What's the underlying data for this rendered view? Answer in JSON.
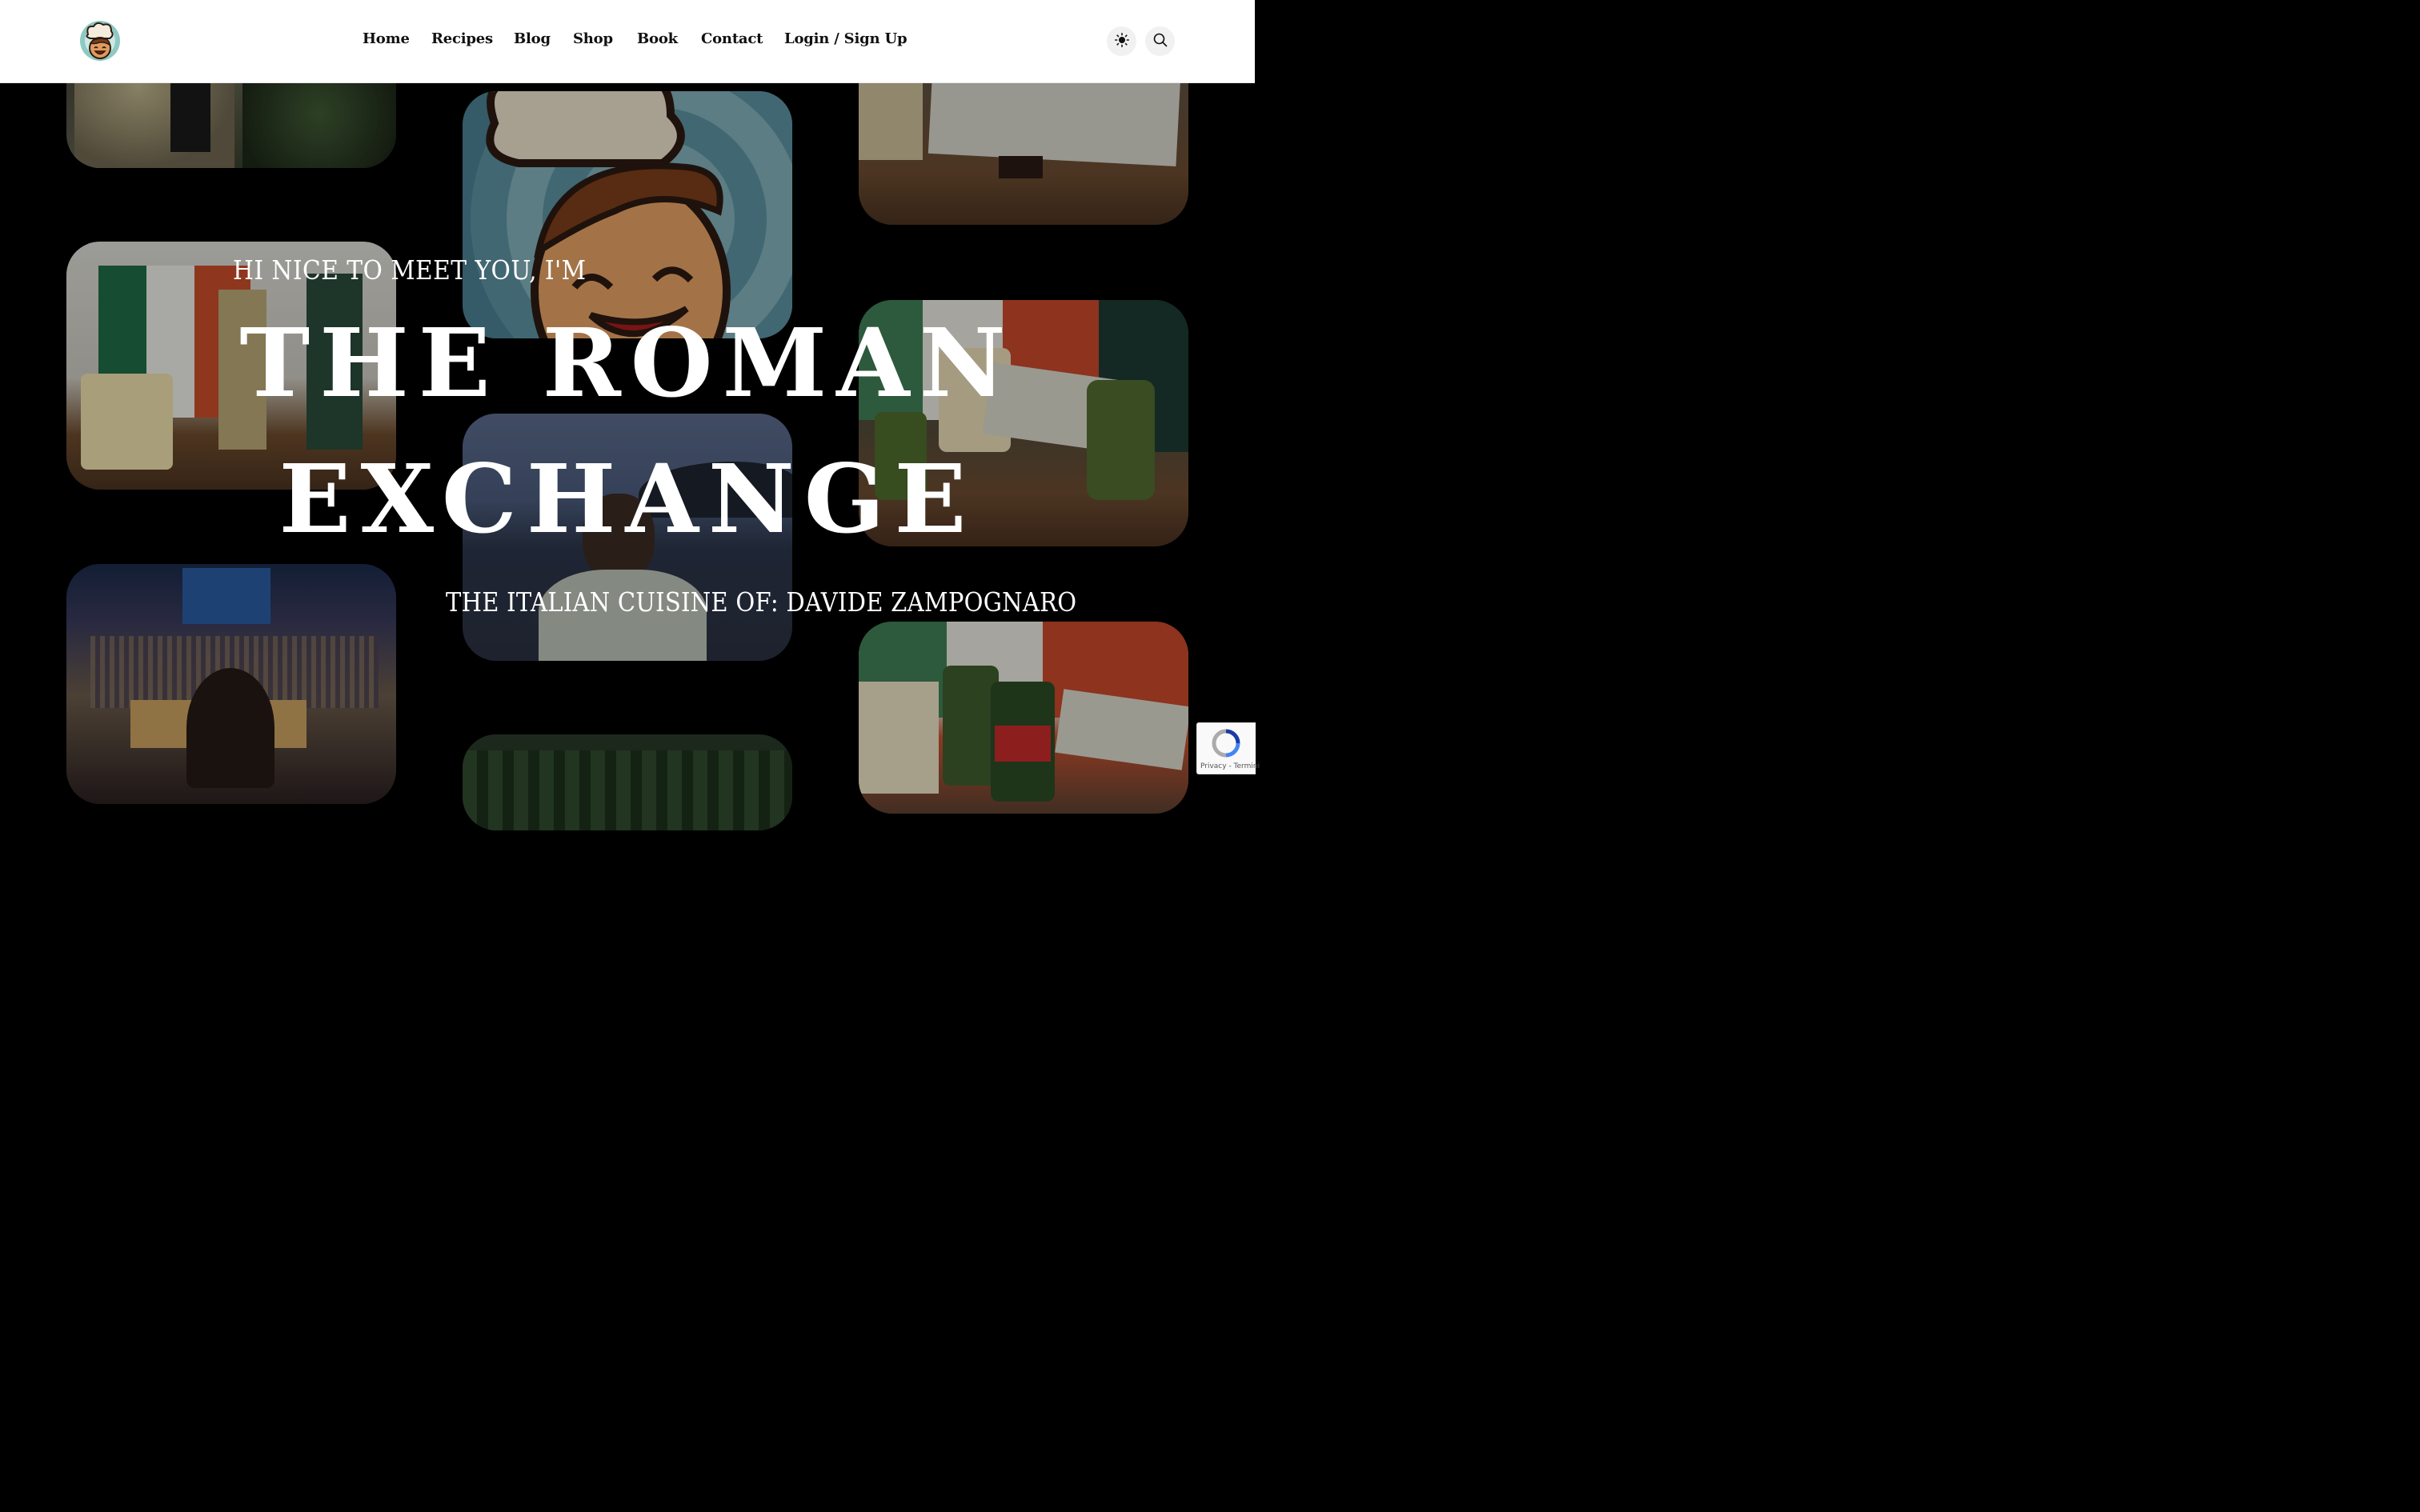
{
  "header": {
    "logo_icon": "chef-mascot-icon",
    "nav": [
      {
        "label": "Home"
      },
      {
        "label": "Recipes"
      },
      {
        "label": "Blog"
      },
      {
        "label": "Shop"
      },
      {
        "label": "Book"
      },
      {
        "label": "Contact"
      },
      {
        "label": "Login / Sign Up"
      }
    ],
    "theme_toggle_icon": "sun-icon",
    "search_icon": "search-icon"
  },
  "hero": {
    "intro": "HI NICE TO MEET YOU, I'M",
    "title_line1": "THE ROMAN",
    "title_line2": "EXCHANGE",
    "subtitle": "THE ITALIAN CUISINE OF: DAVIDE ZAMPOGNARO"
  },
  "recaptcha": {
    "links": "Privacy - Termini"
  },
  "colors": {
    "header_bg": "#ffffff",
    "page_bg": "#000000",
    "text_light": "#ffffff",
    "nav_text": "#111111"
  }
}
